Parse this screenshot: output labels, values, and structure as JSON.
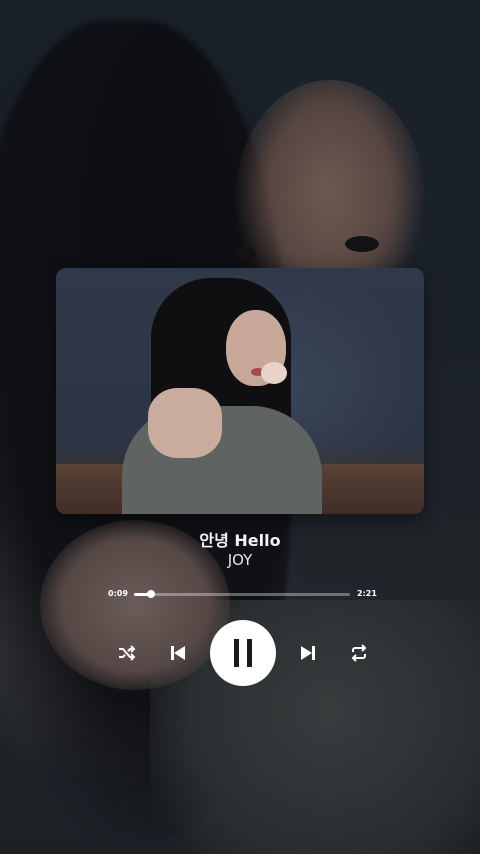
{
  "song": {
    "title": "안녕 Hello",
    "artist": "JOY"
  },
  "progress": {
    "current_time": "0:09",
    "total_time": "2:21",
    "fraction": 0.08
  },
  "controls": {
    "shuffle_icon": "shuffle-icon",
    "previous_icon": "skip-previous-icon",
    "play_pause_icon": "pause-icon",
    "next_icon": "skip-next-icon",
    "repeat_icon": "repeat-icon"
  },
  "colors": {
    "accent": "#ffffff",
    "track_inactive": "#7f8187",
    "background": "#1b2029"
  }
}
